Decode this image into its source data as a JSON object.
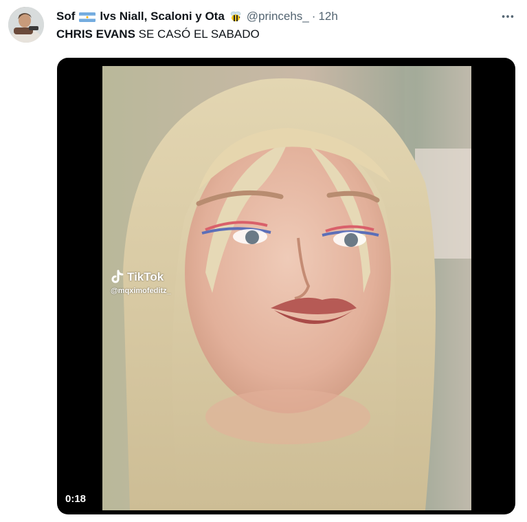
{
  "tweet": {
    "author": {
      "display_name": "Sof",
      "display_name_rest": "lvs Niall, Scaloni y Ota",
      "handle": "@princehs_",
      "separator": "·",
      "time": "12h"
    },
    "text_bold": "CHRIS EVANS",
    "text_rest": " SE CASÓ EL SABADO",
    "media": {
      "watermark_brand": "TikTok",
      "watermark_user": "@mqximofeditz_",
      "duration": "0:18"
    }
  },
  "icons": {
    "more": "more-horizontal-icon",
    "flag": "argentina-flag-emoji",
    "bee": "bee-emoji",
    "tiktok": "tiktok-logo-icon"
  },
  "colors": {
    "text_primary": "#0f1419",
    "text_secondary": "#536471",
    "media_background": "#000000",
    "flag_blue": "#74acdf",
    "flag_sun": "#f6b40e"
  }
}
